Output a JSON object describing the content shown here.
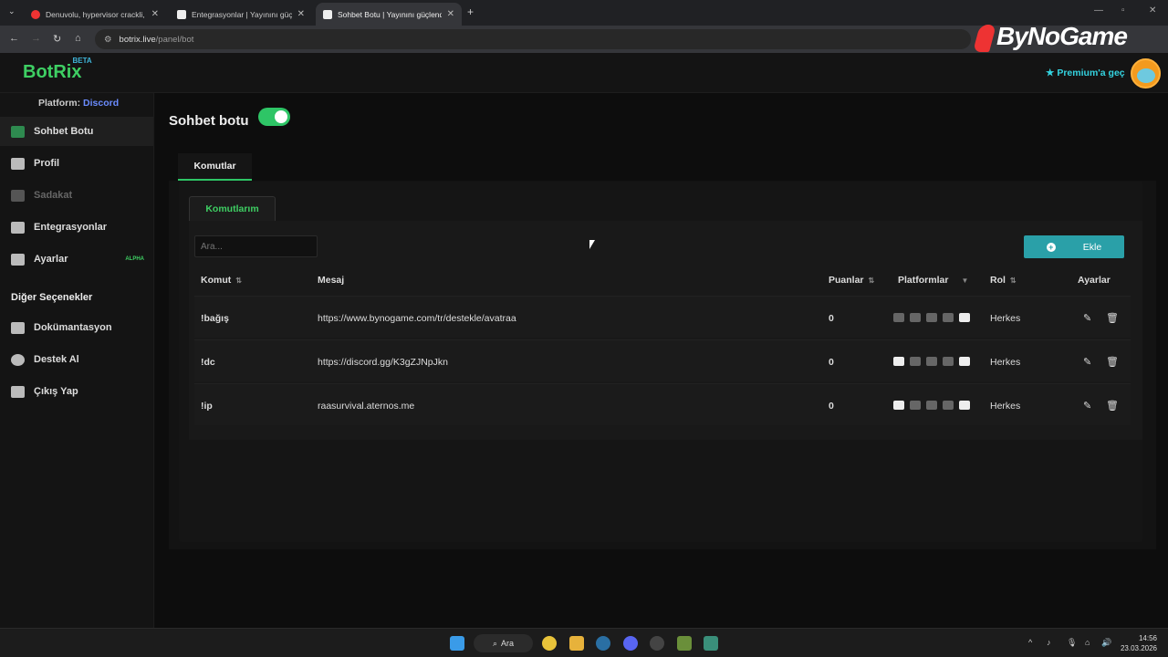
{
  "browser": {
    "tabs": [
      {
        "title": "Denuvolu, hypervisor crackli, ko"
      },
      {
        "title": "Entegrasyonlar | Yayınını güçlen"
      },
      {
        "title": "Sohbet Botu | Yayınını güçlendi"
      }
    ],
    "url_host": "botrix.live",
    "url_path": "/panel/bot",
    "watermark": "ByNoGame"
  },
  "app": {
    "logo": "BotRix",
    "logo_badge": "BETA",
    "premium": "Premium'a geç",
    "platform_label": "Platform:",
    "platform_value": "Discord"
  },
  "sidebar": {
    "items": [
      {
        "label": "Sohbet Botu"
      },
      {
        "label": "Profil"
      },
      {
        "label": "Sadakat"
      },
      {
        "label": "Entegrasyonlar"
      },
      {
        "label": "Ayarlar",
        "badge": "ALPHA"
      }
    ],
    "section": "Diğer Seçenekler",
    "other": [
      {
        "label": "Dokümantasyon"
      },
      {
        "label": "Destek Al"
      },
      {
        "label": "Çıkış Yap"
      }
    ]
  },
  "main": {
    "title": "Sohbet botu",
    "toggle_on": true,
    "tab": "Komutlar",
    "subtab": "Komutlarım",
    "search_placeholder": "Ara...",
    "add_label": "Ekle",
    "columns": [
      "Komut",
      "Mesaj",
      "Puanlar",
      "Platformlar",
      "Rol",
      "Ayarlar"
    ],
    "rows": [
      {
        "command": "!bağış",
        "message": "https://www.bynogame.com/tr/destekle/avatraa",
        "points": "0",
        "role": "Herkes"
      },
      {
        "command": "!dc",
        "message": "https://discord.gg/K3gZJNpJkn",
        "points": "0",
        "role": "Herkes"
      },
      {
        "command": "!ip",
        "message": "raasurvival.aternos.me",
        "points": "0",
        "role": "Herkes"
      }
    ]
  },
  "taskbar": {
    "search": "Ara",
    "time": "14:56",
    "date": "23.03.2026"
  }
}
